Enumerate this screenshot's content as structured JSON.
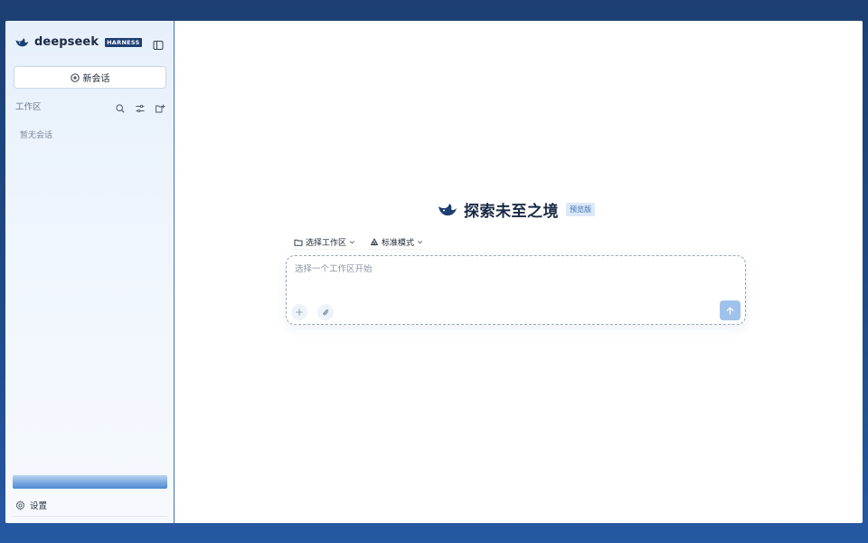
{
  "sidebar": {
    "brand_name": "deepseek",
    "brand_badge": "HARNESS",
    "new_chat_label": "新会话",
    "workspace_label": "工作区",
    "empty_text": "暂无会话",
    "settings_label": "设置"
  },
  "main": {
    "hero_title": "探索未至之境",
    "hero_badge": "预览版",
    "options": {
      "workspace_label": "选择工作区",
      "mode_label": "标准模式"
    },
    "composer": {
      "placeholder": "选择一个工作区开始"
    }
  },
  "icons": {
    "logo": "whale-logo-icon",
    "sidebar_toggle": "sidebar-toggle-icon",
    "new_chat": "plus-circle-icon",
    "search": "search-icon",
    "filter": "sliders-icon",
    "new_folder": "folder-plus-icon",
    "settings": "gear-icon",
    "folder": "folder-icon",
    "mode": "mode-icon",
    "chevron": "chevron-down-icon",
    "add": "plus-icon",
    "attach": "paperclip-icon",
    "send": "arrow-up-icon"
  },
  "colors": {
    "brand": "#1d3f73",
    "accent": "#4f89d2",
    "send_button": "#9ec2ea"
  }
}
